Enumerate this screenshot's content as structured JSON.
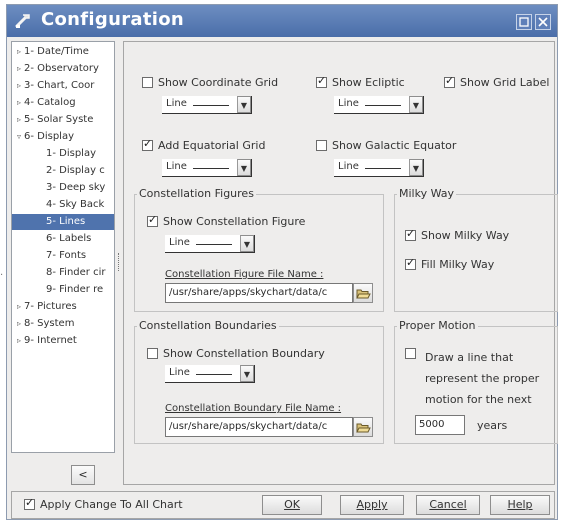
{
  "window": {
    "title": "Configuration"
  },
  "tree": {
    "items": [
      {
        "label": "1- Date/Time",
        "expander": "▹",
        "level": 0,
        "selected": false
      },
      {
        "label": "2- Observatory",
        "expander": "▹",
        "level": 0,
        "selected": false
      },
      {
        "label": "3- Chart, Coor",
        "expander": "▹",
        "level": 0,
        "selected": false
      },
      {
        "label": "4- Catalog",
        "expander": "▹",
        "level": 0,
        "selected": false
      },
      {
        "label": "5- Solar Syste",
        "expander": "▹",
        "level": 0,
        "selected": false
      },
      {
        "label": "6- Display",
        "expander": "▿",
        "level": 0,
        "selected": false
      },
      {
        "label": "1- Display",
        "expander": "",
        "level": 1,
        "selected": false
      },
      {
        "label": "2- Display c",
        "expander": "",
        "level": 1,
        "selected": false
      },
      {
        "label": "3- Deep sky",
        "expander": "",
        "level": 1,
        "selected": false
      },
      {
        "label": "4- Sky Back",
        "expander": "",
        "level": 1,
        "selected": false
      },
      {
        "label": "5- Lines",
        "expander": "",
        "level": 1,
        "selected": true
      },
      {
        "label": "6- Labels",
        "expander": "",
        "level": 1,
        "selected": false
      },
      {
        "label": "7- Fonts",
        "expander": "",
        "level": 1,
        "selected": false
      },
      {
        "label": "8- Finder cir",
        "expander": "",
        "level": 1,
        "selected": false
      },
      {
        "label": "9- Finder re",
        "expander": "",
        "level": 1,
        "selected": false
      },
      {
        "label": "7- Pictures",
        "expander": "▹",
        "level": 0,
        "selected": false
      },
      {
        "label": "8- System",
        "expander": "▹",
        "level": 0,
        "selected": false
      },
      {
        "label": "9- Internet",
        "expander": "▹",
        "level": 0,
        "selected": false
      }
    ],
    "collapse_label": "<"
  },
  "lines": {
    "coord_grid": {
      "label": "Show Coordinate Grid",
      "checked": false,
      "style": "Line"
    },
    "ecliptic": {
      "label": "Show Ecliptic",
      "checked": true,
      "style": "Line"
    },
    "grid_label": {
      "label": "Show Grid Label",
      "checked": true
    },
    "equatorial_grid": {
      "label": "Add Equatorial Grid",
      "checked": true,
      "style": "Line"
    },
    "galactic_equator": {
      "label": "Show Galactic Equator",
      "checked": false,
      "style": "Line"
    }
  },
  "constellation_figures": {
    "title": "Constellation Figures",
    "show": {
      "label": "Show Constellation Figure",
      "checked": true,
      "style": "Line"
    },
    "file_label": "Constellation Figure File Name :",
    "file_value": "/usr/share/apps/skychart/data/c"
  },
  "milky_way": {
    "title": "Milky Way",
    "show": {
      "label": "Show Milky Way",
      "checked": true
    },
    "fill": {
      "label": "Fill Milky Way",
      "checked": true
    }
  },
  "constellation_boundaries": {
    "title": "Constellation Boundaries",
    "show": {
      "label": "Show Constellation Boundary",
      "checked": false,
      "style": "Line"
    },
    "file_label": "Constellation Boundary File Name :",
    "file_value": "/usr/share/apps/skychart/data/c"
  },
  "proper_motion": {
    "title": "Proper Motion",
    "draw": {
      "checked": false,
      "line1": "Draw a line that",
      "line2": "represent the proper",
      "line3": "motion for the next"
    },
    "years_value": "5000",
    "years_label": "years"
  },
  "footer": {
    "apply_all": {
      "label": "Apply Change To All Chart",
      "checked": true
    },
    "ok": "OK",
    "apply": "Apply",
    "cancel": "Cancel",
    "help": "Help"
  },
  "icons": {
    "app": "config-wrench-icon",
    "maximize": "maximize-icon",
    "close": "close-icon",
    "open": "folder-open-icon",
    "dropdown": "chevron-down-icon"
  },
  "colors": {
    "titlebar": "#5a7db5",
    "selection": "#4f73ad",
    "background": "#eeedec"
  }
}
